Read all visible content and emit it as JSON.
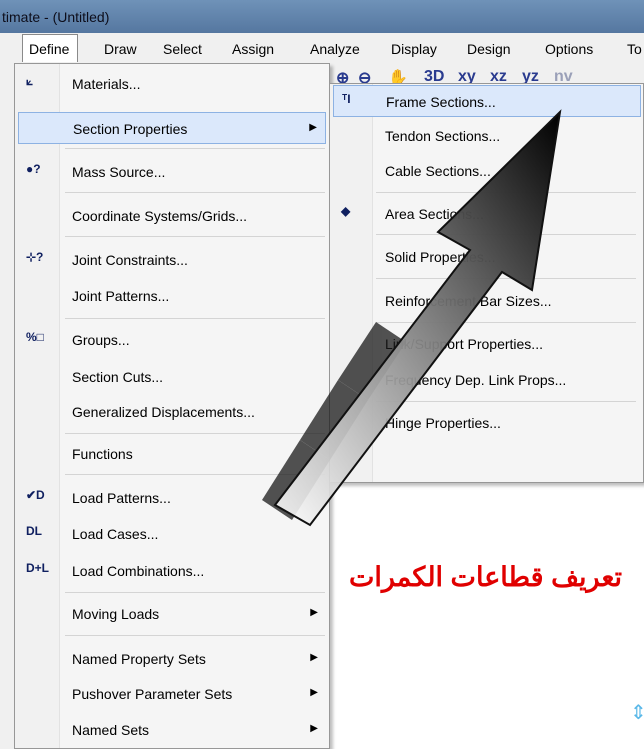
{
  "window": {
    "title": "timate  - (Untitled)"
  },
  "menubar": [
    "Define",
    "Draw",
    "Select",
    "Assign",
    "Analyze",
    "Display",
    "Design",
    "Options",
    "To"
  ],
  "toolbar": [
    {
      "icon": "zoom-in-icon",
      "glyph": "⊕"
    },
    {
      "icon": "zoom-out-icon",
      "glyph": "⊖"
    },
    {
      "icon": "pan-hand-icon",
      "glyph": "✋"
    },
    {
      "icon": "view-3d-icon",
      "glyph": "3D"
    },
    {
      "icon": "view-xy-icon",
      "glyph": "xy"
    },
    {
      "icon": "view-xz-icon",
      "glyph": "xz"
    },
    {
      "icon": "view-yz-icon",
      "glyph": "yz"
    },
    {
      "icon": "view-nv-icon",
      "glyph": "nv"
    }
  ],
  "define_menu": [
    {
      "label": "Materials...",
      "icon": "materials-icon",
      "glyph": "⟀"
    },
    {
      "label": "Section Properties",
      "submenu": true,
      "highlighted": true
    },
    {
      "label": "Mass Source...",
      "icon": "mass-source-icon",
      "glyph": "●?"
    },
    {
      "label": "Coordinate Systems/Grids..."
    },
    {
      "label": "Joint Constraints...",
      "icon": "joint-constraints-icon",
      "glyph": "⊹?"
    },
    {
      "label": "Joint Patterns..."
    },
    {
      "label": "Groups...",
      "icon": "groups-icon",
      "glyph": "%□"
    },
    {
      "label": "Section Cuts..."
    },
    {
      "label": "Generalized Displacements..."
    },
    {
      "label": "Functions"
    },
    {
      "label": "Load Patterns...",
      "icon": "load-patterns-icon",
      "glyph": "✔D"
    },
    {
      "label": "Load Cases...",
      "icon": "load-cases-icon",
      "glyph": "DL"
    },
    {
      "label": "Load Combinations...",
      "icon": "load-combinations-icon",
      "glyph": "D+L"
    },
    {
      "label": "Moving Loads",
      "submenu": true
    },
    {
      "label": "Named Property Sets",
      "submenu": true
    },
    {
      "label": "Pushover Parameter Sets",
      "submenu": true
    },
    {
      "label": "Named Sets",
      "submenu": true
    }
  ],
  "section_submenu": [
    {
      "label": "Frame Sections...",
      "icon": "frame-sections-icon",
      "glyph": "ᵀI",
      "highlighted": true
    },
    {
      "label": "Tendon Sections..."
    },
    {
      "label": "Cable Sections..."
    },
    {
      "label": "Area Sections...",
      "icon": "area-sections-icon",
      "glyph": "◆"
    },
    {
      "label": "Solid Properties..."
    },
    {
      "label": "Reinforcement Bar Sizes..."
    },
    {
      "label": "Link/Support Properties..."
    },
    {
      "label": "Frequency Dep. Link Props..."
    },
    {
      "label": "Hinge Properties..."
    }
  ],
  "annotation": {
    "text": "تعريف قطاعات الكمرات",
    "color": "#e00000"
  },
  "colors": {
    "highlight": "#dbe8fb",
    "highlight_border": "#8db2e3",
    "titlebar": "#5a7ca5"
  }
}
